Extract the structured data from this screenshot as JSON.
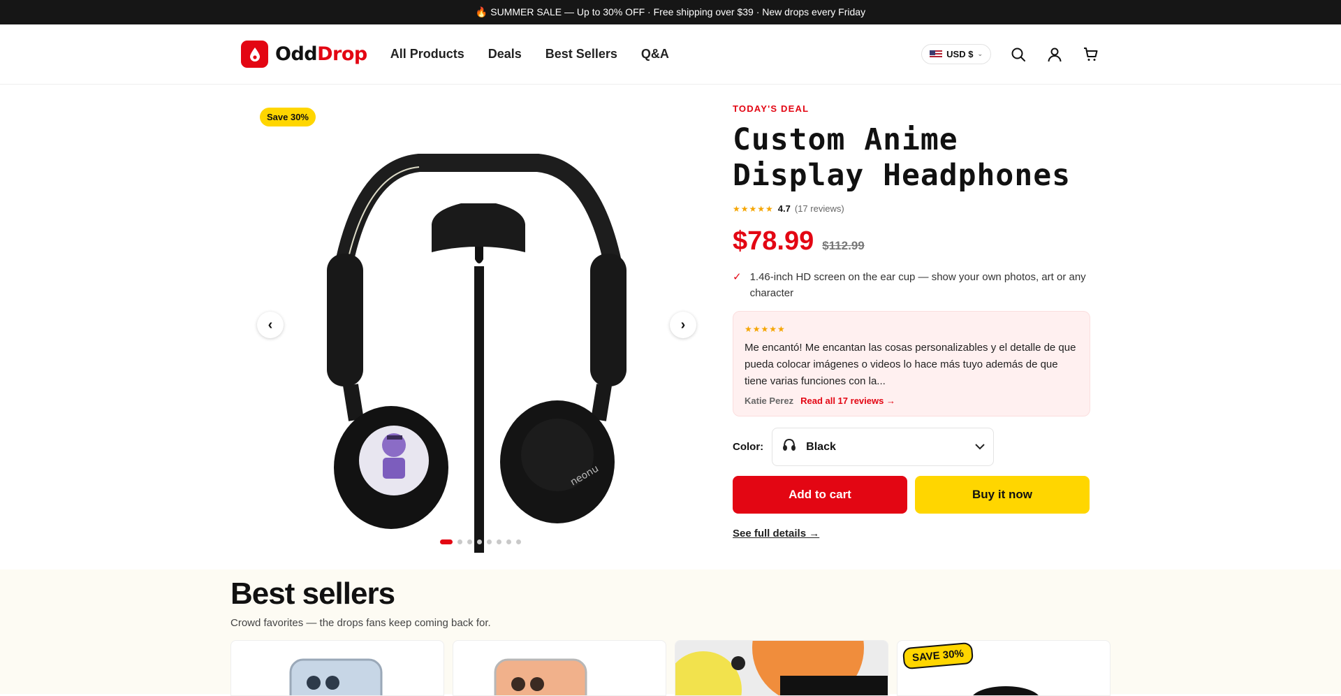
{
  "announcement": "🔥 SUMMER SALE — Up to 30% OFF · Free shipping over $39 · New drops every Friday",
  "brand": {
    "part1": "Odd",
    "part2": "Drop",
    "accent": "#e30613"
  },
  "nav": [
    {
      "label": "All Products"
    },
    {
      "label": "Deals"
    },
    {
      "label": "Best Sellers"
    },
    {
      "label": "Q&A"
    }
  ],
  "header": {
    "currency": "USD $",
    "icons": [
      "search-icon",
      "account-icon",
      "cart-icon"
    ]
  },
  "gallery": {
    "badge": "Save 30%",
    "prev_label": "‹",
    "next_label": "›",
    "dot_count": 8,
    "active_dot": 1
  },
  "product": {
    "eyebrow": "TODAY'S DEAL",
    "title": "Custom Anime Display Headphones",
    "stars": "★★★★★",
    "rating": "4.7",
    "review_count": "(17 reviews)",
    "price": "$78.99",
    "compare_price": "$112.99",
    "check": "✓",
    "feature": "1.46-inch HD screen on the ear cup — show your own photos, art or any character",
    "review": {
      "stars": "★★★★★",
      "text": "Me encantó! Me encantan las cosas personalizables y el detalle de que pueda colocar imágenes o videos lo hace más tuyo además de que tiene varias funciones con la...",
      "author": "Katie Perez",
      "link": "Read all 17 reviews →"
    },
    "color_label": "Color:",
    "color_value": "Black",
    "add_to_cart": "Add to cart",
    "buy_now": "Buy it now",
    "details_link": "See full details →"
  },
  "best_sellers": {
    "title": "Best sellers",
    "subtitle": "Crowd favorites — the drops fans keep coming back for.",
    "badge": "SAVE 30%"
  }
}
